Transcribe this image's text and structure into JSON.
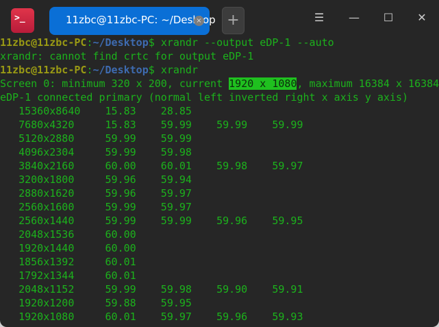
{
  "titlebar": {
    "tab_title": "11zbc@11zbc-PC: ~/Desktop",
    "tab_close": "×",
    "new_tab": "+",
    "menu": "☰",
    "minimize": "—",
    "maximize": "☐",
    "close": "✕"
  },
  "terminal": {
    "prompt_user": "11zbc@11zbc-PC",
    "prompt_sep": ":",
    "prompt_path": "~/Desktop",
    "prompt_end": "$ ",
    "cmd1": "xrandr --output eDP-1 --auto",
    "err1": "xrandr: cannot find crtc for output eDP-1",
    "cmd2": "xrandr",
    "screen_pre": "Screen 0: minimum 320 x 200, current ",
    "screen_current": "1920 x 1080",
    "screen_post": ", maximum 16384 x 16384",
    "output_line": "eDP-1 connected primary (normal left inverted right x axis y axis)",
    "modes": [
      [
        "15360x8640",
        "15.83",
        "28.85"
      ],
      [
        "7680x4320",
        "15.83",
        "59.99",
        "59.99",
        "59.99"
      ],
      [
        "5120x2880",
        "59.99",
        "59.99"
      ],
      [
        "4096x2304",
        "59.99",
        "59.98"
      ],
      [
        "3840x2160",
        "60.00",
        "60.01",
        "59.98",
        "59.97"
      ],
      [
        "3200x1800",
        "59.96",
        "59.94"
      ],
      [
        "2880x1620",
        "59.96",
        "59.97"
      ],
      [
        "2560x1600",
        "59.99",
        "59.97"
      ],
      [
        "2560x1440",
        "59.99",
        "59.99",
        "59.96",
        "59.95"
      ],
      [
        "2048x1536",
        "60.00"
      ],
      [
        "1920x1440",
        "60.00"
      ],
      [
        "1856x1392",
        "60.01"
      ],
      [
        "1792x1344",
        "60.01"
      ],
      [
        "2048x1152",
        "59.99",
        "59.98",
        "59.90",
        "59.91"
      ],
      [
        "1920x1200",
        "59.88",
        "59.95"
      ],
      [
        "1920x1080",
        "60.01",
        "59.97",
        "59.96",
        "59.93"
      ]
    ]
  }
}
